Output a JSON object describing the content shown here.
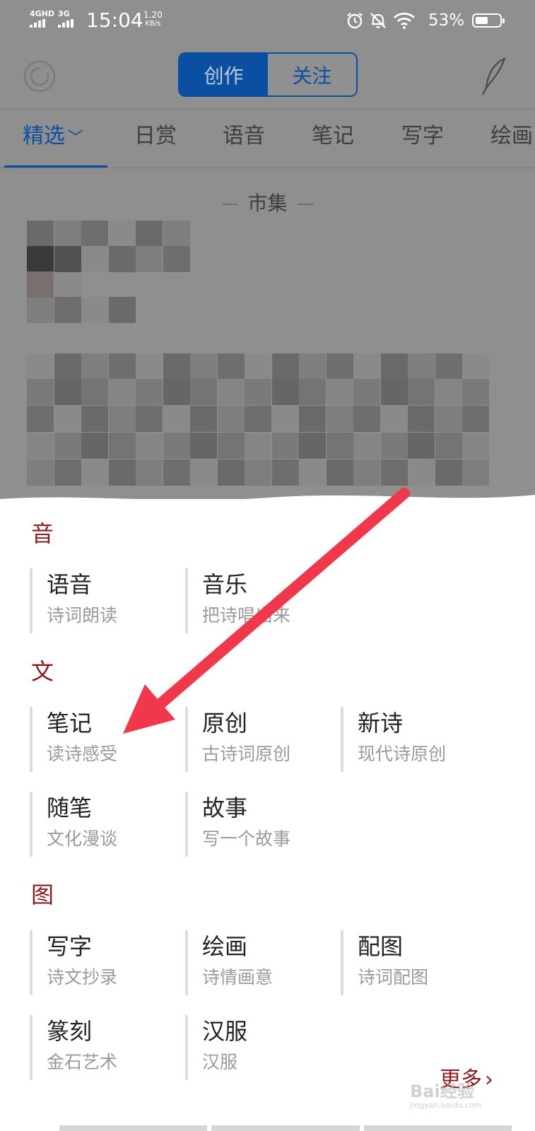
{
  "status_bar": {
    "net1": "4GHD",
    "net2": "3G",
    "time": "15:04",
    "speed_value": "1.20",
    "speed_unit": "KB/s",
    "battery": "53%",
    "battery_level": 0.53
  },
  "header": {
    "seg_create": "创作",
    "seg_follow": "关注"
  },
  "tabs": [
    "精选",
    "日赏",
    "语音",
    "笔记",
    "写字",
    "绘画"
  ],
  "market_label": "市集",
  "sections": [
    {
      "title": "音",
      "items": [
        {
          "title": "语音",
          "subtitle": "诗词朗读"
        },
        {
          "title": "音乐",
          "subtitle": "把诗唱出来"
        }
      ]
    },
    {
      "title": "文",
      "items": [
        {
          "title": "笔记",
          "subtitle": "读诗感受"
        },
        {
          "title": "原创",
          "subtitle": "古诗词原创"
        },
        {
          "title": "新诗",
          "subtitle": "现代诗原创"
        },
        {
          "title": "随笔",
          "subtitle": "文化漫谈"
        },
        {
          "title": "故事",
          "subtitle": "写一个故事"
        }
      ]
    },
    {
      "title": "图",
      "items": [
        {
          "title": "写字",
          "subtitle": "诗文抄录"
        },
        {
          "title": "绘画",
          "subtitle": "诗情画意"
        },
        {
          "title": "配图",
          "subtitle": "诗词配图"
        },
        {
          "title": "篆刻",
          "subtitle": "金石艺术"
        },
        {
          "title": "汉服",
          "subtitle": "汉服"
        }
      ]
    }
  ],
  "more_label": "更多",
  "watermark": {
    "main": "Bai经验",
    "sub": "jingyan.baidu.com"
  },
  "colors": {
    "accent_blue": "#0a4fa1",
    "section_red": "#8b1a1a",
    "arrow_red": "#f0384a",
    "overlay_gray": "#8f8f8f"
  }
}
